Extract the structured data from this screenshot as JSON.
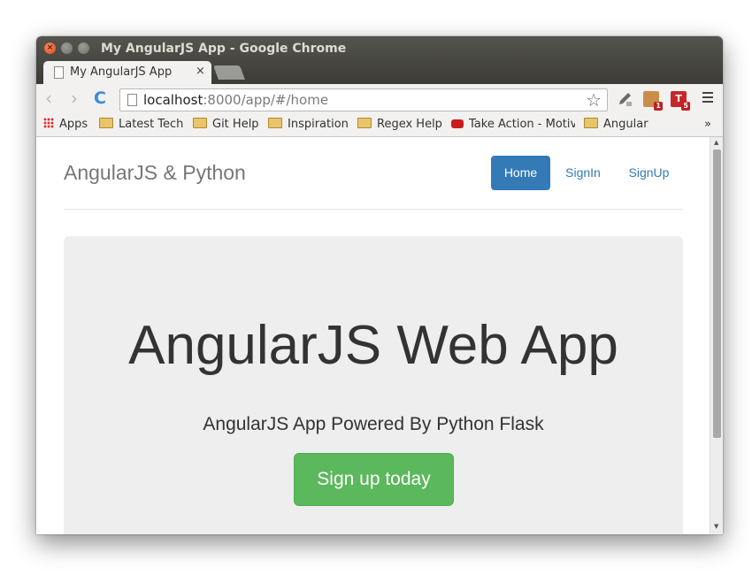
{
  "window": {
    "title": "My AngularJS App - Google Chrome",
    "controls": {
      "close": "×",
      "minimize": "–",
      "maximize": "□"
    }
  },
  "tab": {
    "title": "My AngularJS App",
    "close": "×"
  },
  "toolbar": {
    "back": "‹",
    "forward": "›",
    "reload": "C",
    "url_host": "localhost",
    "url_rest": ":8000/app/#/home",
    "bookmark_star": "☆",
    "extensions": [
      {
        "name": "eyedropper",
        "color": "#6b6b6b"
      },
      {
        "name": "extension-1",
        "color": "#c98e4a",
        "badge": "1"
      },
      {
        "name": "extension-td",
        "color": "#c62828",
        "label": "T",
        "badge": "5"
      }
    ]
  },
  "bookmarks": {
    "items": [
      "Apps",
      "Latest Tech",
      "Git Help",
      "Inspiration",
      "Regex Help",
      "Take Action - Motiv",
      "Angular"
    ],
    "overflow": "»"
  },
  "page": {
    "brand": "AngularJS & Python",
    "nav": {
      "home": "Home",
      "signin": "SignIn",
      "signup": "SignUp"
    },
    "jumbotron": {
      "headline": "AngularJS Web App",
      "lead": "AngularJS App Powered By Python Flask",
      "cta": "Sign up today"
    }
  },
  "colors": {
    "primary": "#337ab7",
    "success": "#5cb85c",
    "jumbotron_bg": "#eeeeee"
  }
}
